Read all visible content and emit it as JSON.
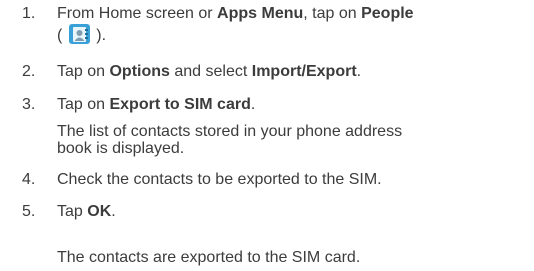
{
  "steps": [
    {
      "number": "1.",
      "line1_a": "From Home screen or ",
      "line1_b": "Apps Menu",
      "line1_c": ", tap on ",
      "line1_d": "People",
      "line2_open": "(",
      "line2_close": ")."
    },
    {
      "number": "2.",
      "a": "Tap on ",
      "b": "Options",
      "c": " and select ",
      "d": "Import/Export",
      "e": "."
    },
    {
      "number": "3.",
      "a": "Tap on ",
      "b": "Export to SIM card",
      "c": ".",
      "note_line1": "The list of contacts stored in your phone address",
      "note_line2": "book is displayed."
    },
    {
      "number": "4.",
      "a": "Check the contacts to be exported to the SIM."
    },
    {
      "number": "5.",
      "a": "Tap ",
      "b": "OK",
      "c": "."
    }
  ],
  "result": "The contacts are exported to the SIM card.",
  "icons": {
    "people": "people-contacts-icon"
  },
  "colors": {
    "text": "#3c3c3c",
    "icon_blue": "#3aa0d8"
  }
}
